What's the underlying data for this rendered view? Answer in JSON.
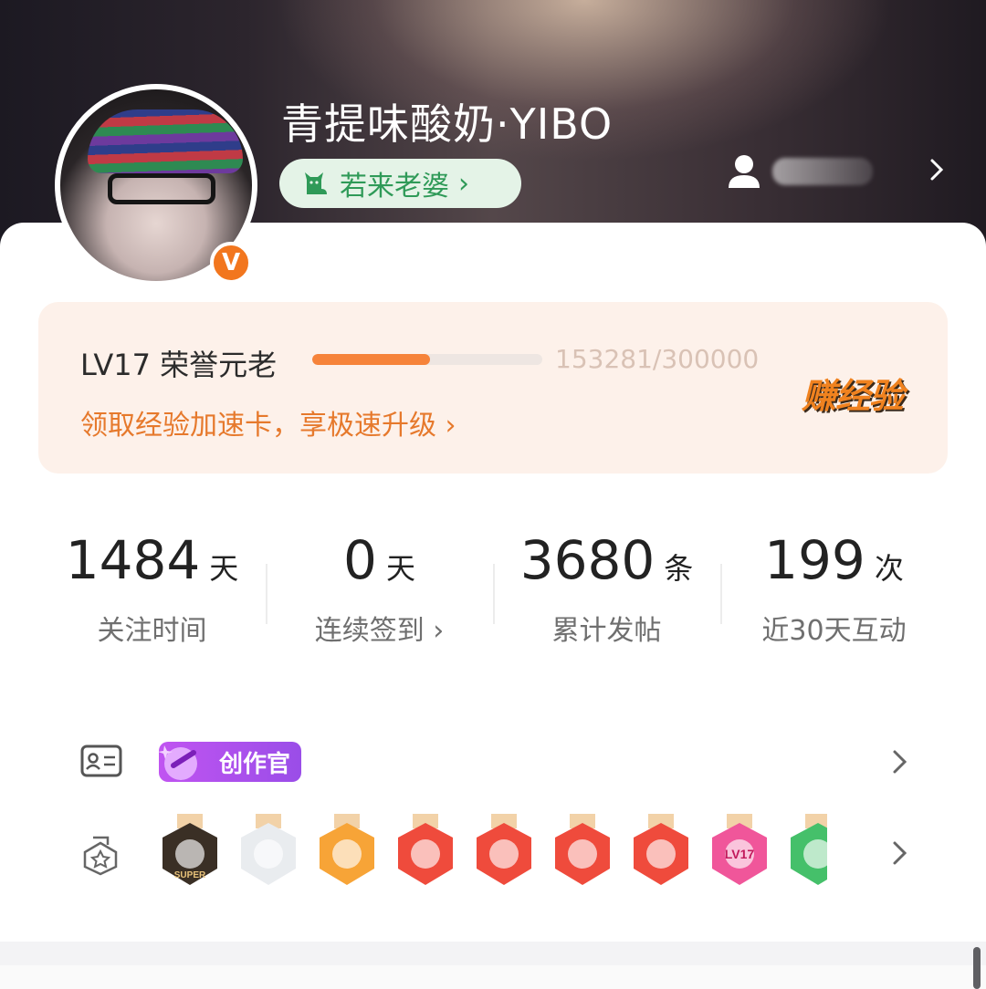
{
  "profile": {
    "username": "青提味酸奶·YIBO",
    "verified_badge": "V",
    "fan_title": "若来老婆",
    "fan_title_icon": "cat-icon",
    "fan_title_color": "#2f9a58",
    "top_right_icon": "user-icon"
  },
  "level": {
    "title": "LV17 荣誉元老",
    "xp_current": 153281,
    "xp_total": 300000,
    "xp_text": "153281/300000",
    "progress_fraction": 0.511,
    "link_text": "领取经验加速卡，享极速升级",
    "earn_button": "赚经验",
    "accent_color": "#f6833a"
  },
  "stats": [
    {
      "value": "1484",
      "unit": "天",
      "label": "关注时间"
    },
    {
      "value": "0",
      "unit": "天",
      "label": "连续签到",
      "has_chevron": true
    },
    {
      "value": "3680",
      "unit": "条",
      "label": "累计发帖"
    },
    {
      "value": "199",
      "unit": "次",
      "label": "近30天互动"
    }
  ],
  "identity_row": {
    "icon": "id-card-icon",
    "tag_label": "创作官",
    "tag_color": "#b352ef"
  },
  "medals_row": {
    "icon": "medal-outline-icon",
    "medals": [
      {
        "name": "super-medal",
        "text": "SUPER",
        "color": "#3a2f25"
      },
      {
        "name": "character-medal",
        "color": "#e9ecef"
      },
      {
        "name": "crown-medal",
        "color": "#f7a437"
      },
      {
        "name": "dragon-medal-1",
        "color": "#ef4b3c"
      },
      {
        "name": "dragon-medal-2",
        "color": "#ef4b3c"
      },
      {
        "name": "dragon-medal-3",
        "color": "#ef4b3c"
      },
      {
        "name": "rabbit-medal",
        "color": "#ef4b3c"
      },
      {
        "name": "lv17-medal",
        "text": "LV17",
        "color": "#f0569a"
      },
      {
        "name": "green-medal",
        "color": "#45c06a"
      }
    ]
  }
}
